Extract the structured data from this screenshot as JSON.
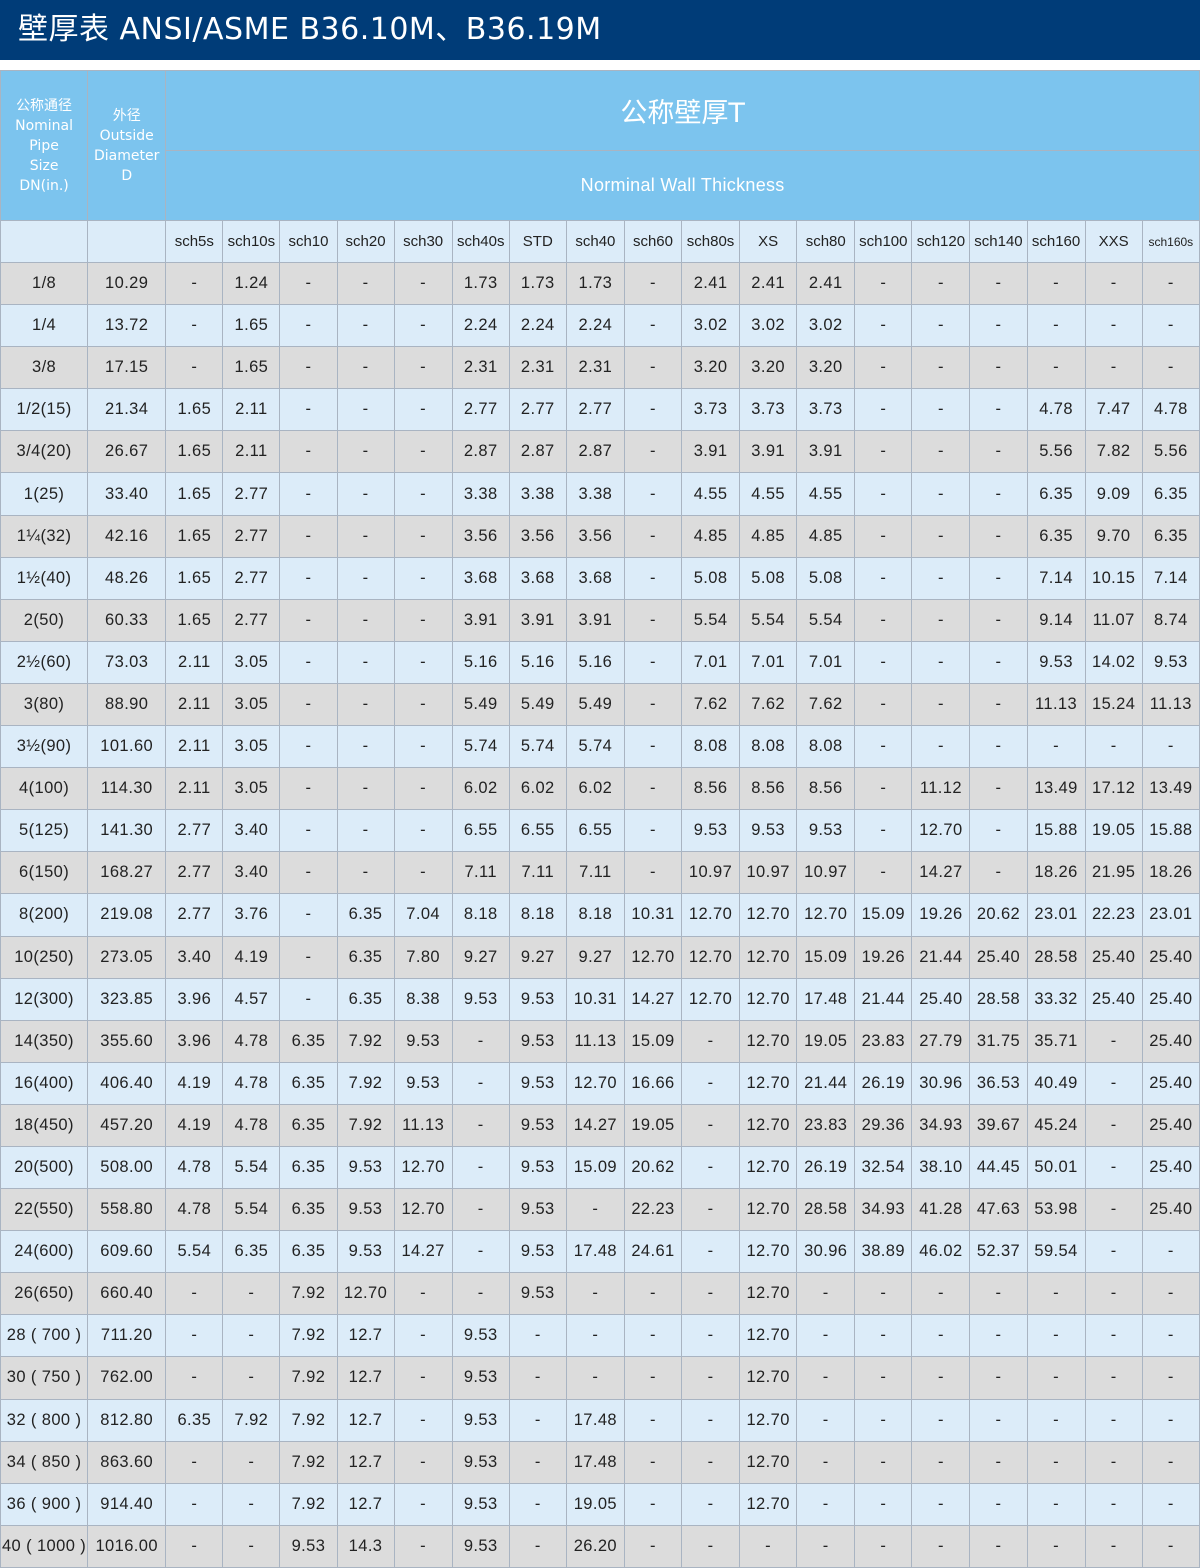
{
  "title": "壁厚表 ANSI/ASME B36.10M、B36.19M",
  "header": {
    "nominal_size": [
      "公称通径",
      "Nominal",
      "Pipe",
      "Size",
      "DN(in.)"
    ],
    "outside_diameter": [
      "外径",
      "Outside",
      "Diameter",
      "D"
    ],
    "wall_title": "公称壁厚T",
    "wall_subtitle": "Norminal Wall Thickness"
  },
  "schedules": [
    "sch5s",
    "sch10s",
    "sch10",
    "sch20",
    "sch30",
    "sch40s",
    "STD",
    "sch40",
    "sch60",
    "sch80s",
    "XS",
    "sch80",
    "sch100",
    "sch120",
    "sch140",
    "sch160",
    "XXS",
    "sch160s"
  ],
  "rows": [
    [
      "1/8",
      "10.29",
      "-",
      "1.24",
      "-",
      "-",
      "-",
      "1.73",
      "1.73",
      "1.73",
      "-",
      "2.41",
      "2.41",
      "2.41",
      "-",
      "-",
      "-",
      "-",
      "-",
      "-"
    ],
    [
      "1/4",
      "13.72",
      "-",
      "1.65",
      "-",
      "-",
      "-",
      "2.24",
      "2.24",
      "2.24",
      "-",
      "3.02",
      "3.02",
      "3.02",
      "-",
      "-",
      "-",
      "-",
      "-",
      "-"
    ],
    [
      "3/8",
      "17.15",
      "-",
      "1.65",
      "-",
      "-",
      "-",
      "2.31",
      "2.31",
      "2.31",
      "-",
      "3.20",
      "3.20",
      "3.20",
      "-",
      "-",
      "-",
      "-",
      "-",
      "-"
    ],
    [
      "1/2(15)",
      "21.34",
      "1.65",
      "2.11",
      "-",
      "-",
      "-",
      "2.77",
      "2.77",
      "2.77",
      "-",
      "3.73",
      "3.73",
      "3.73",
      "-",
      "-",
      "-",
      "4.78",
      "7.47",
      "4.78"
    ],
    [
      "3/4(20)",
      "26.67",
      "1.65",
      "2.11",
      "-",
      "-",
      "-",
      "2.87",
      "2.87",
      "2.87",
      "-",
      "3.91",
      "3.91",
      "3.91",
      "-",
      "-",
      "-",
      "5.56",
      "7.82",
      "5.56"
    ],
    [
      "1(25)",
      "33.40",
      "1.65",
      "2.77",
      "-",
      "-",
      "-",
      "3.38",
      "3.38",
      "3.38",
      "-",
      "4.55",
      "4.55",
      "4.55",
      "-",
      "-",
      "-",
      "6.35",
      "9.09",
      "6.35"
    ],
    [
      "1¼(32)",
      "42.16",
      "1.65",
      "2.77",
      "-",
      "-",
      "-",
      "3.56",
      "3.56",
      "3.56",
      "-",
      "4.85",
      "4.85",
      "4.85",
      "-",
      "-",
      "-",
      "6.35",
      "9.70",
      "6.35"
    ],
    [
      "1½(40)",
      "48.26",
      "1.65",
      "2.77",
      "-",
      "-",
      "-",
      "3.68",
      "3.68",
      "3.68",
      "-",
      "5.08",
      "5.08",
      "5.08",
      "-",
      "-",
      "-",
      "7.14",
      "10.15",
      "7.14"
    ],
    [
      "2(50)",
      "60.33",
      "1.65",
      "2.77",
      "-",
      "-",
      "-",
      "3.91",
      "3.91",
      "3.91",
      "-",
      "5.54",
      "5.54",
      "5.54",
      "-",
      "-",
      "-",
      "9.14",
      "11.07",
      "8.74"
    ],
    [
      "2½(60)",
      "73.03",
      "2.11",
      "3.05",
      "-",
      "-",
      "-",
      "5.16",
      "5.16",
      "5.16",
      "-",
      "7.01",
      "7.01",
      "7.01",
      "-",
      "-",
      "-",
      "9.53",
      "14.02",
      "9.53"
    ],
    [
      "3(80)",
      "88.90",
      "2.11",
      "3.05",
      "-",
      "-",
      "-",
      "5.49",
      "5.49",
      "5.49",
      "-",
      "7.62",
      "7.62",
      "7.62",
      "-",
      "-",
      "-",
      "11.13",
      "15.24",
      "11.13"
    ],
    [
      "3½(90)",
      "101.60",
      "2.11",
      "3.05",
      "-",
      "-",
      "-",
      "5.74",
      "5.74",
      "5.74",
      "-",
      "8.08",
      "8.08",
      "8.08",
      "-",
      "-",
      "-",
      "-",
      "-",
      "-"
    ],
    [
      "4(100)",
      "114.30",
      "2.11",
      "3.05",
      "-",
      "-",
      "-",
      "6.02",
      "6.02",
      "6.02",
      "-",
      "8.56",
      "8.56",
      "8.56",
      "-",
      "11.12",
      "-",
      "13.49",
      "17.12",
      "13.49"
    ],
    [
      "5(125)",
      "141.30",
      "2.77",
      "3.40",
      "-",
      "-",
      "-",
      "6.55",
      "6.55",
      "6.55",
      "-",
      "9.53",
      "9.53",
      "9.53",
      "-",
      "12.70",
      "-",
      "15.88",
      "19.05",
      "15.88"
    ],
    [
      "6(150)",
      "168.27",
      "2.77",
      "3.40",
      "-",
      "-",
      "-",
      "7.11",
      "7.11",
      "7.11",
      "-",
      "10.97",
      "10.97",
      "10.97",
      "-",
      "14.27",
      "-",
      "18.26",
      "21.95",
      "18.26"
    ],
    [
      "8(200)",
      "219.08",
      "2.77",
      "3.76",
      "-",
      "6.35",
      "7.04",
      "8.18",
      "8.18",
      "8.18",
      "10.31",
      "12.70",
      "12.70",
      "12.70",
      "15.09",
      "19.26",
      "20.62",
      "23.01",
      "22.23",
      "23.01"
    ],
    [
      "10(250)",
      "273.05",
      "3.40",
      "4.19",
      "-",
      "6.35",
      "7.80",
      "9.27",
      "9.27",
      "9.27",
      "12.70",
      "12.70",
      "12.70",
      "15.09",
      "19.26",
      "21.44",
      "25.40",
      "28.58",
      "25.40",
      "25.40"
    ],
    [
      "12(300)",
      "323.85",
      "3.96",
      "4.57",
      "-",
      "6.35",
      "8.38",
      "9.53",
      "9.53",
      "10.31",
      "14.27",
      "12.70",
      "12.70",
      "17.48",
      "21.44",
      "25.40",
      "28.58",
      "33.32",
      "25.40",
      "25.40"
    ],
    [
      "14(350)",
      "355.60",
      "3.96",
      "4.78",
      "6.35",
      "7.92",
      "9.53",
      "-",
      "9.53",
      "11.13",
      "15.09",
      "-",
      "12.70",
      "19.05",
      "23.83",
      "27.79",
      "31.75",
      "35.71",
      "-",
      "25.40"
    ],
    [
      "16(400)",
      "406.40",
      "4.19",
      "4.78",
      "6.35",
      "7.92",
      "9.53",
      "-",
      "9.53",
      "12.70",
      "16.66",
      "-",
      "12.70",
      "21.44",
      "26.19",
      "30.96",
      "36.53",
      "40.49",
      "-",
      "25.40"
    ],
    [
      "18(450)",
      "457.20",
      "4.19",
      "4.78",
      "6.35",
      "7.92",
      "11.13",
      "-",
      "9.53",
      "14.27",
      "19.05",
      "-",
      "12.70",
      "23.83",
      "29.36",
      "34.93",
      "39.67",
      "45.24",
      "-",
      "25.40"
    ],
    [
      "20(500)",
      "508.00",
      "4.78",
      "5.54",
      "6.35",
      "9.53",
      "12.70",
      "-",
      "9.53",
      "15.09",
      "20.62",
      "-",
      "12.70",
      "26.19",
      "32.54",
      "38.10",
      "44.45",
      "50.01",
      "-",
      "25.40"
    ],
    [
      "22(550)",
      "558.80",
      "4.78",
      "5.54",
      "6.35",
      "9.53",
      "12.70",
      "-",
      "9.53",
      "-",
      "22.23",
      "-",
      "12.70",
      "28.58",
      "34.93",
      "41.28",
      "47.63",
      "53.98",
      "-",
      "25.40"
    ],
    [
      "24(600)",
      "609.60",
      "5.54",
      "6.35",
      "6.35",
      "9.53",
      "14.27",
      "-",
      "9.53",
      "17.48",
      "24.61",
      "-",
      "12.70",
      "30.96",
      "38.89",
      "46.02",
      "52.37",
      "59.54",
      "-",
      "-"
    ],
    [
      "26(650)",
      "660.40",
      "-",
      "-",
      "7.92",
      "12.70",
      "-",
      "-",
      "9.53",
      "-",
      "-",
      "-",
      "12.70",
      "-",
      "-",
      "-",
      "-",
      "-",
      "-",
      "-"
    ],
    [
      "28 ( 700 )",
      "711.20",
      "-",
      "-",
      "7.92",
      "12.7",
      "-",
      "9.53",
      "-",
      "-",
      "-",
      "-",
      "12.70",
      "-",
      "-",
      "-",
      "-",
      "-",
      "-",
      "-"
    ],
    [
      "30 ( 750 )",
      "762.00",
      "-",
      "-",
      "7.92",
      "12.7",
      "-",
      "9.53",
      "-",
      "-",
      "-",
      "-",
      "12.70",
      "-",
      "-",
      "-",
      "-",
      "-",
      "-",
      "-"
    ],
    [
      "32 ( 800 )",
      "812.80",
      "6.35",
      "7.92",
      "7.92",
      "12.7",
      "-",
      "9.53",
      "-",
      "17.48",
      "-",
      "-",
      "12.70",
      "-",
      "-",
      "-",
      "-",
      "-",
      "-",
      "-"
    ],
    [
      "34 ( 850 )",
      "863.60",
      "-",
      "-",
      "7.92",
      "12.7",
      "-",
      "9.53",
      "-",
      "17.48",
      "-",
      "-",
      "12.70",
      "-",
      "-",
      "-",
      "-",
      "-",
      "-",
      "-"
    ],
    [
      "36 ( 900 )",
      "914.40",
      "-",
      "-",
      "7.92",
      "12.7",
      "-",
      "9.53",
      "-",
      "19.05",
      "-",
      "-",
      "12.70",
      "-",
      "-",
      "-",
      "-",
      "-",
      "-",
      "-"
    ],
    [
      "40 ( 1000 )",
      "1016.00",
      "-",
      "-",
      "9.53",
      "14.3",
      "-",
      "9.53",
      "-",
      "26.20",
      "-",
      "-",
      "-",
      "-",
      "-",
      "-",
      "-",
      "-",
      "-",
      "-"
    ]
  ],
  "colors": {
    "title_bar": "#003c78",
    "header_blue": "#7cc4ee",
    "row_light_blue": "#dcecf9",
    "row_gray": "#dcdcdc",
    "grid": "#a9b4c2"
  }
}
